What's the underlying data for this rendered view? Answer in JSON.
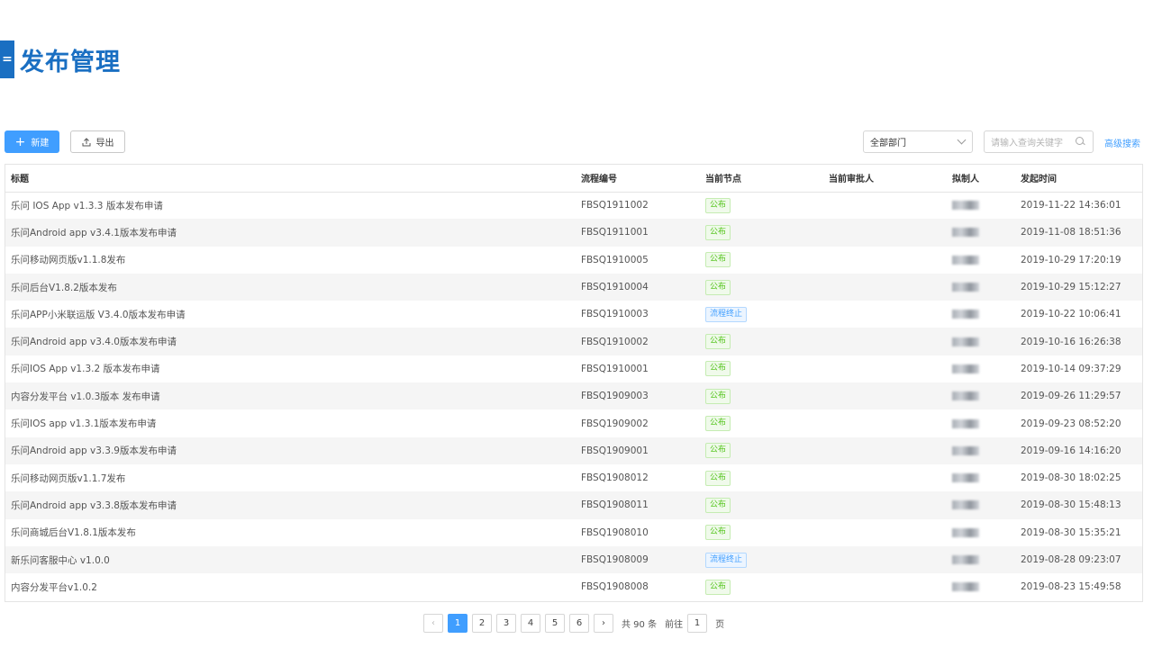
{
  "header": {
    "title": "发布管理",
    "bar_glyph": "="
  },
  "toolbar": {
    "new_label": "新建",
    "export_label": "导出",
    "department_select": "全部部门",
    "search_placeholder": "请输入查询关键字",
    "advanced_search": "高级搜索"
  },
  "table": {
    "columns": [
      "标题",
      "流程编号",
      "当前节点",
      "当前审批人",
      "拟制人",
      "发起时间"
    ],
    "rows": [
      {
        "title": "乐问 IOS App v1.3.3 版本发布申请",
        "id": "FBSQ1911002",
        "node": "公布",
        "node_type": "pub",
        "approver": "",
        "time": "2019-11-22 14:36:01"
      },
      {
        "title": "乐问Android app v3.4.1版本发布申请",
        "id": "FBSQ1911001",
        "node": "公布",
        "node_type": "pub",
        "approver": "",
        "time": "2019-11-08 18:51:36"
      },
      {
        "title": "乐问移动网页版v1.1.8发布",
        "id": "FBSQ1910005",
        "node": "公布",
        "node_type": "pub",
        "approver": "",
        "time": "2019-10-29 17:20:19"
      },
      {
        "title": "乐问后台V1.8.2版本发布",
        "id": "FBSQ1910004",
        "node": "公布",
        "node_type": "pub",
        "approver": "",
        "time": "2019-10-29 15:12:27"
      },
      {
        "title": "乐问APP小米联运版 V3.4.0版本发布申请",
        "id": "FBSQ1910003",
        "node": "流程终止",
        "node_type": "stop",
        "approver": "",
        "time": "2019-10-22 10:06:41"
      },
      {
        "title": "乐问Android app v3.4.0版本发布申请",
        "id": "FBSQ1910002",
        "node": "公布",
        "node_type": "pub",
        "approver": "",
        "time": "2019-10-16 16:26:38"
      },
      {
        "title": "乐问IOS App v1.3.2 版本发布申请",
        "id": "FBSQ1910001",
        "node": "公布",
        "node_type": "pub",
        "approver": "",
        "time": "2019-10-14 09:37:29"
      },
      {
        "title": "内容分发平台 v1.0.3版本 发布申请",
        "id": "FBSQ1909003",
        "node": "公布",
        "node_type": "pub",
        "approver": "",
        "time": "2019-09-26 11:29:57"
      },
      {
        "title": "乐问IOS app v1.3.1版本发布申请",
        "id": "FBSQ1909002",
        "node": "公布",
        "node_type": "pub",
        "approver": "",
        "time": "2019-09-23 08:52:20"
      },
      {
        "title": "乐问Android app v3.3.9版本发布申请",
        "id": "FBSQ1909001",
        "node": "公布",
        "node_type": "pub",
        "approver": "",
        "time": "2019-09-16 14:16:20"
      },
      {
        "title": "乐问移动网页版v1.1.7发布",
        "id": "FBSQ1908012",
        "node": "公布",
        "node_type": "pub",
        "approver": "",
        "time": "2019-08-30 18:02:25"
      },
      {
        "title": "乐问Android app v3.3.8版本发布申请",
        "id": "FBSQ1908011",
        "node": "公布",
        "node_type": "pub",
        "approver": "",
        "time": "2019-08-30 15:48:13"
      },
      {
        "title": "乐问商城后台V1.8.1版本发布",
        "id": "FBSQ1908010",
        "node": "公布",
        "node_type": "pub",
        "approver": "",
        "time": "2019-08-30 15:35:21"
      },
      {
        "title": "新乐问客服中心 v1.0.0",
        "id": "FBSQ1908009",
        "node": "流程终止",
        "node_type": "stop",
        "approver": "",
        "time": "2019-08-28 09:23:07"
      },
      {
        "title": "内容分发平台v1.0.2",
        "id": "FBSQ1908008",
        "node": "公布",
        "node_type": "pub",
        "approver": "",
        "time": "2019-08-23 15:49:58"
      }
    ]
  },
  "pagination": {
    "pages": [
      "1",
      "2",
      "3",
      "4",
      "5",
      "6"
    ],
    "current": "1",
    "total_text": "共 90 条",
    "goto_prefix": "前往",
    "goto_value": "1",
    "goto_suffix": "页",
    "prev_glyph": "‹",
    "next_glyph": "›"
  },
  "colors": {
    "primary": "#409eff",
    "brand": "#1a6fc2",
    "published": "#52c41a"
  }
}
